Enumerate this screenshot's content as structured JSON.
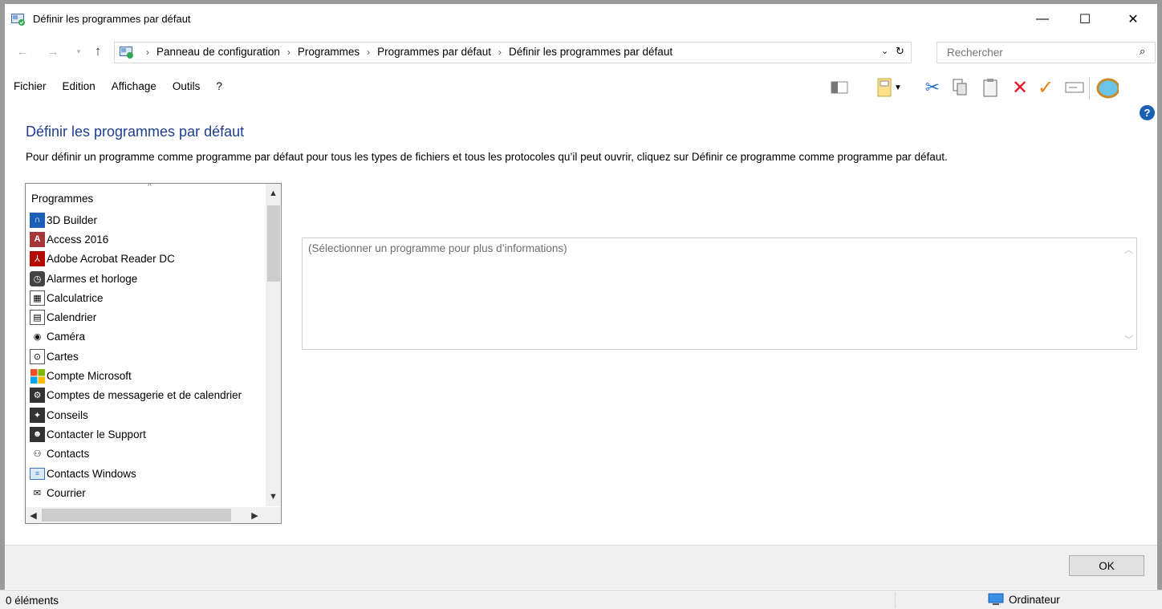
{
  "window": {
    "title": "Définir les programmes par défaut",
    "controls": {
      "minimize": "—",
      "maximize": "☐",
      "close": "✕"
    }
  },
  "address": {
    "breadcrumbs": [
      "Panneau de configuration",
      "Programmes",
      "Programmes par défaut",
      "Définir les programmes par défaut"
    ],
    "search_placeholder": "Rechercher"
  },
  "menu": [
    "Fichier",
    "Edition",
    "Affichage",
    "Outils",
    "?"
  ],
  "toolbar_icons": [
    "layout-pane-icon",
    "properties-icon",
    "dropdown-arrow-icon",
    "cut-icon",
    "copy-icon",
    "paste-icon",
    "delete-icon",
    "check-icon",
    "rename-icon",
    "shell-icon"
  ],
  "colors": {
    "heading": "#1e3f8c",
    "delete": "#e81123",
    "check": "#f07c0c",
    "help": "#1a5fb4"
  },
  "page": {
    "heading": "Définir les programmes par défaut",
    "description": "Pour définir un programme comme programme par défaut pour tous les types de fichiers et tous les protocoles qu’il peut ouvrir, cliquez sur Définir ce programme comme programme par défaut."
  },
  "program_list": {
    "header": "Programmes",
    "items": [
      {
        "label": "3D Builder",
        "icon": "3d-builder-icon"
      },
      {
        "label": "Access 2016",
        "icon": "access-icon"
      },
      {
        "label": "Adobe Acrobat Reader DC",
        "icon": "acrobat-icon"
      },
      {
        "label": "Alarmes et horloge",
        "icon": "alarm-clock-icon"
      },
      {
        "label": "Calculatrice",
        "icon": "calculator-icon"
      },
      {
        "label": "Calendrier",
        "icon": "calendar-icon"
      },
      {
        "label": "Caméra",
        "icon": "camera-icon"
      },
      {
        "label": "Cartes",
        "icon": "maps-icon"
      },
      {
        "label": "Compte Microsoft",
        "icon": "microsoft-logo-icon"
      },
      {
        "label": "Comptes de messagerie et de calendrier",
        "icon": "gear-icon"
      },
      {
        "label": "Conseils",
        "icon": "lightbulb-icon"
      },
      {
        "label": "Contacter le Support",
        "icon": "support-person-icon"
      },
      {
        "label": "Contacts",
        "icon": "contacts-icon"
      },
      {
        "label": "Contacts Windows",
        "icon": "contact-card-icon"
      },
      {
        "label": "Courrier",
        "icon": "mail-icon"
      }
    ]
  },
  "info_panel": {
    "text": "(Sélectionner un programme pour plus d’informations)"
  },
  "buttons": {
    "ok": "OK"
  },
  "status": {
    "count": "0 éléments",
    "zone": "Ordinateur"
  }
}
